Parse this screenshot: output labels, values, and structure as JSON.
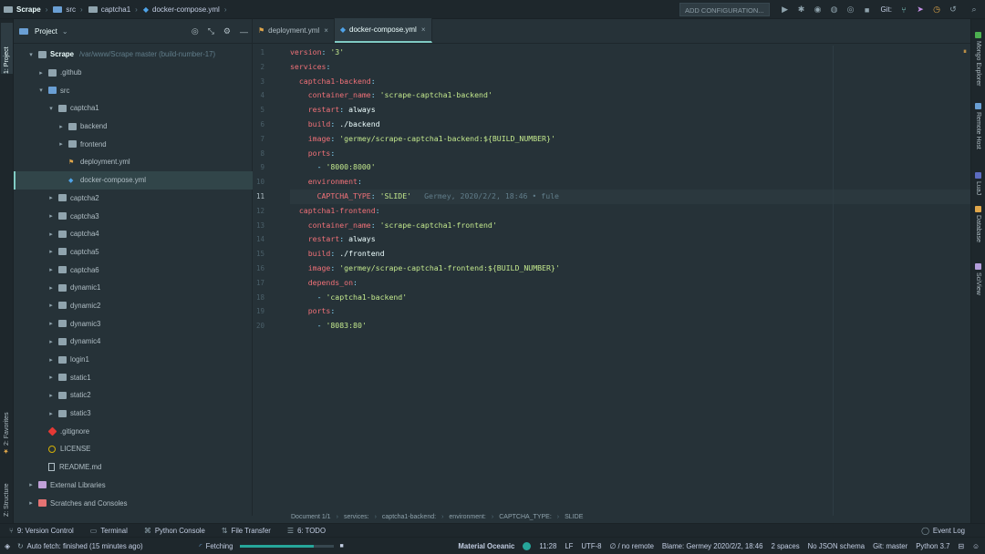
{
  "breadcrumbs": [
    "Scrape",
    "src",
    "captcha1",
    "docker-compose.yml"
  ],
  "toolbar": {
    "add_config_label": "ADD CONFIGURATION...",
    "git_label": "Git:"
  },
  "left_strip": {
    "project_tab": "1: Project",
    "favorites_tab": "2: Favorites",
    "structure_tab": "Z: Structure"
  },
  "right_strip": [
    {
      "label": "Mongo Explorer",
      "icon": "mongo-icon",
      "color": "#4caf50"
    },
    {
      "label": "Remote Host",
      "icon": "remote-host-icon",
      "color": "#6a9fd4"
    },
    {
      "label": "LuaJ",
      "icon": "lua-icon",
      "color": "#5c6bc0"
    },
    {
      "label": "Database",
      "icon": "database-icon",
      "color": "#e0a64a"
    },
    {
      "label": "SciView",
      "icon": "sciview-icon",
      "color": "#b39ddb"
    }
  ],
  "project": {
    "header_label": "Project",
    "tree": [
      {
        "label": "Scrape",
        "path": "/var/www/Scrape master (build-number-17)",
        "indent": 0,
        "chev": "▾",
        "icon": "folder",
        "root": true
      },
      {
        "label": ".github",
        "indent": 1,
        "chev": "▸",
        "icon": "folder"
      },
      {
        "label": "src",
        "indent": 1,
        "chev": "▾",
        "icon": "src"
      },
      {
        "label": "captcha1",
        "indent": 2,
        "chev": "▾",
        "icon": "folder"
      },
      {
        "label": "backend",
        "indent": 3,
        "chev": "▸",
        "icon": "folder"
      },
      {
        "label": "frontend",
        "indent": 3,
        "chev": "▸",
        "icon": "folder"
      },
      {
        "label": "deployment.yml",
        "indent": 3,
        "chev": "",
        "icon": "yml"
      },
      {
        "label": "docker-compose.yml",
        "indent": 3,
        "chev": "",
        "icon": "docker",
        "selected": true
      },
      {
        "label": "captcha2",
        "indent": 2,
        "chev": "▸",
        "icon": "folder"
      },
      {
        "label": "captcha3",
        "indent": 2,
        "chev": "▸",
        "icon": "folder"
      },
      {
        "label": "captcha4",
        "indent": 2,
        "chev": "▸",
        "icon": "folder"
      },
      {
        "label": "captcha5",
        "indent": 2,
        "chev": "▸",
        "icon": "folder"
      },
      {
        "label": "captcha6",
        "indent": 2,
        "chev": "▸",
        "icon": "folder"
      },
      {
        "label": "dynamic1",
        "indent": 2,
        "chev": "▸",
        "icon": "folder"
      },
      {
        "label": "dynamic2",
        "indent": 2,
        "chev": "▸",
        "icon": "folder"
      },
      {
        "label": "dynamic3",
        "indent": 2,
        "chev": "▸",
        "icon": "folder"
      },
      {
        "label": "dynamic4",
        "indent": 2,
        "chev": "▸",
        "icon": "folder"
      },
      {
        "label": "login1",
        "indent": 2,
        "chev": "▸",
        "icon": "folder"
      },
      {
        "label": "static1",
        "indent": 2,
        "chev": "▸",
        "icon": "folder"
      },
      {
        "label": "static2",
        "indent": 2,
        "chev": "▸",
        "icon": "folder"
      },
      {
        "label": "static3",
        "indent": 2,
        "chev": "▸",
        "icon": "folder"
      },
      {
        "label": ".gitignore",
        "indent": 1,
        "chev": "",
        "icon": "git"
      },
      {
        "label": "LICENSE",
        "indent": 1,
        "chev": "",
        "icon": "license"
      },
      {
        "label": "README.md",
        "indent": 1,
        "chev": "",
        "icon": "md"
      },
      {
        "label": "External Libraries",
        "indent": 0,
        "chev": "▸",
        "icon": "lib"
      },
      {
        "label": "Scratches and Consoles",
        "indent": 0,
        "chev": "▸",
        "icon": "scratch"
      }
    ]
  },
  "tabs": [
    {
      "label": "deployment.yml",
      "icon": "yml",
      "active": false
    },
    {
      "label": "docker-compose.yml",
      "icon": "docker",
      "active": true
    }
  ],
  "code_lines": [
    [
      [
        "k",
        "version"
      ],
      [
        "p",
        ": "
      ],
      [
        "s",
        "'3'"
      ]
    ],
    [
      [
        "k",
        "services"
      ],
      [
        "p",
        ":"
      ]
    ],
    [
      [
        "v",
        "  "
      ],
      [
        "k",
        "captcha1-backend"
      ],
      [
        "p",
        ":"
      ]
    ],
    [
      [
        "v",
        "    "
      ],
      [
        "k",
        "container_name"
      ],
      [
        "p",
        ": "
      ],
      [
        "s",
        "'scrape-captcha1-backend'"
      ]
    ],
    [
      [
        "v",
        "    "
      ],
      [
        "k",
        "restart"
      ],
      [
        "p",
        ": "
      ],
      [
        "v",
        "always"
      ]
    ],
    [
      [
        "v",
        "    "
      ],
      [
        "k",
        "build"
      ],
      [
        "p",
        ": "
      ],
      [
        "v",
        "./backend"
      ]
    ],
    [
      [
        "v",
        "    "
      ],
      [
        "k",
        "image"
      ],
      [
        "p",
        ": "
      ],
      [
        "s",
        "'germey/scrape-captcha1-backend:${BUILD_NUMBER}'"
      ]
    ],
    [
      [
        "v",
        "    "
      ],
      [
        "k",
        "ports"
      ],
      [
        "p",
        ":"
      ]
    ],
    [
      [
        "v",
        "      "
      ],
      [
        "p",
        "- "
      ],
      [
        "s",
        "'8000:8000'"
      ]
    ],
    [
      [
        "v",
        "    "
      ],
      [
        "k",
        "environment"
      ],
      [
        "p",
        ":"
      ]
    ],
    [
      [
        "v",
        "      "
      ],
      [
        "k",
        "CAPTCHA_TYPE"
      ],
      [
        "p",
        ": "
      ],
      [
        "s",
        "'SLIDE'"
      ]
    ],
    [
      [
        "v",
        "  "
      ],
      [
        "k",
        "captcha1-frontend"
      ],
      [
        "p",
        ":"
      ]
    ],
    [
      [
        "v",
        "    "
      ],
      [
        "k",
        "container_name"
      ],
      [
        "p",
        ": "
      ],
      [
        "s",
        "'scrape-captcha1-frontend'"
      ]
    ],
    [
      [
        "v",
        "    "
      ],
      [
        "k",
        "restart"
      ],
      [
        "p",
        ": "
      ],
      [
        "v",
        "always"
      ]
    ],
    [
      [
        "v",
        "    "
      ],
      [
        "k",
        "build"
      ],
      [
        "p",
        ": "
      ],
      [
        "v",
        "./frontend"
      ]
    ],
    [
      [
        "v",
        "    "
      ],
      [
        "k",
        "image"
      ],
      [
        "p",
        ": "
      ],
      [
        "s",
        "'germey/scrape-captcha1-frontend:${BUILD_NUMBER}'"
      ]
    ],
    [
      [
        "v",
        "    "
      ],
      [
        "k",
        "depends_on"
      ],
      [
        "p",
        ":"
      ]
    ],
    [
      [
        "v",
        "      "
      ],
      [
        "p",
        "- "
      ],
      [
        "s",
        "'captcha1-backend'"
      ]
    ],
    [
      [
        "v",
        "    "
      ],
      [
        "k",
        "ports"
      ],
      [
        "p",
        ":"
      ]
    ],
    [
      [
        "v",
        "      "
      ],
      [
        "p",
        "- "
      ],
      [
        "s",
        "'8083:80'"
      ]
    ]
  ],
  "current_line": 11,
  "blame_annotation": "Germey, 2020/2/2, 18:46 • fule",
  "editor_breadcrumb": [
    "Document 1/1",
    "services:",
    "captcha1-backend:",
    "environment:",
    "CAPTCHA_TYPE:",
    "SLIDE"
  ],
  "tool_windows": [
    {
      "label": "9: Version Control",
      "icon": "version-control-icon",
      "glyph": "⑂"
    },
    {
      "label": "Terminal",
      "icon": "terminal-icon",
      "glyph": "▭"
    },
    {
      "label": "Python Console",
      "icon": "python-console-icon",
      "glyph": "⌘"
    },
    {
      "label": "File Transfer",
      "icon": "file-transfer-icon",
      "glyph": "⇅"
    },
    {
      "label": "6: TODO",
      "icon": "todo-icon",
      "glyph": "☰"
    }
  ],
  "event_log": "Event Log",
  "status_bar": {
    "message": "Auto fetch: finished (15 minutes ago)",
    "task": "Fetching",
    "progress": 0.78,
    "theme": "Material Oceanic",
    "position": "11:28",
    "line_sep": "LF",
    "encoding": "UTF-8",
    "remote": "∅ / no remote",
    "blame": "Blame: Germey 2020/2/2, 18:46",
    "indent": "2 spaces",
    "schema": "No JSON schema",
    "git": "Git: master",
    "python": "Python 3.7"
  },
  "colors": {
    "accent": "#80cbc4",
    "key": "#f07178",
    "string": "#c3e88d",
    "punct": "#89ddff"
  }
}
